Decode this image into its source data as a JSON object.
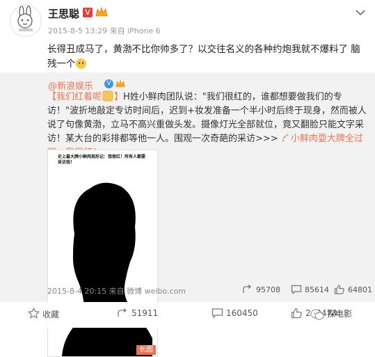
{
  "post": {
    "author": "王思聪",
    "vip_badge": "V",
    "meta": "2015-8-5 13:29 来自 iPhone 6",
    "text": "长得丑成马了，黄渤不比你帅多了？以交往名义的各种约炮我就不爆料了  脑残一个"
  },
  "repost": {
    "author": "@新浪娱乐",
    "topic": "【我们红着呢",
    "topic_end": "】",
    "text": "H姓小鲜肉团队说：\"我们很红的，谁都想要做我们的专访！\"波折地敲定专访时间后，迟到+妆发准备一个半小时后终于现身，然而被人说了句像黄渤，立马不高兴重做头发。摄像灯光全部就位，竟又翻脸只能文字采访！某大台的彩排都等他一人。围观一次奇葩的采访>>>",
    "link": "小鲜肉耍大牌全过程：我很红！",
    "image_caption": "史上最大牌小鲜肉现形记：我很红！所有人都要采访我！",
    "image_badge": "长图",
    "meta": "2015-8-4 20:15 来自 微博 weibo.com",
    "reposts": "95708",
    "comments": "85614",
    "likes": "64801"
  },
  "actions": {
    "favorite": "收藏",
    "repost": "51911",
    "comment": "160450",
    "like": "240474"
  },
  "watermark": "探电影",
  "colors": {
    "accent": "#eb7350",
    "repost_bg": "#f2f2f2",
    "vip_red": "#e5403e"
  }
}
